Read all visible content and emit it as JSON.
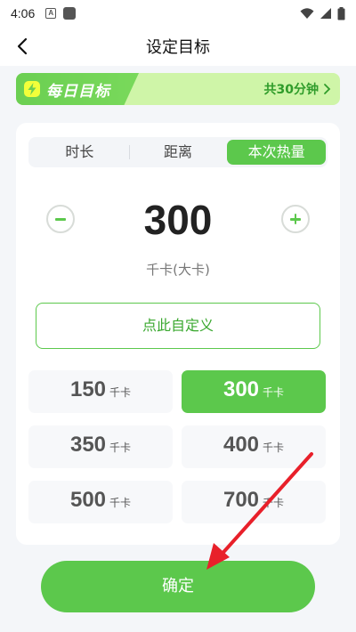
{
  "status_bar": {
    "time": "4:06",
    "notif_letter": "A"
  },
  "header": {
    "title": "设定目标"
  },
  "goal": {
    "badge": "每日目标",
    "summary": "共30分钟"
  },
  "tabs": [
    {
      "label": "时长",
      "active": false
    },
    {
      "label": "距离",
      "active": false
    },
    {
      "label": "本次热量",
      "active": true
    }
  ],
  "value": {
    "amount": "300",
    "unit": "千卡(大卡)"
  },
  "custom_label": "点此自定义",
  "presets": [
    {
      "value": "150",
      "unit": "千卡",
      "selected": false
    },
    {
      "value": "300",
      "unit": "千卡",
      "selected": true
    },
    {
      "value": "350",
      "unit": "千卡",
      "selected": false
    },
    {
      "value": "400",
      "unit": "千卡",
      "selected": false
    },
    {
      "value": "500",
      "unit": "千卡",
      "selected": false
    },
    {
      "value": "700",
      "unit": "千卡",
      "selected": false
    }
  ],
  "confirm_label": "确定",
  "colors": {
    "accent": "#5cc84c",
    "banner": "#cff5a8",
    "annotation_arrow": "#e8202a"
  }
}
